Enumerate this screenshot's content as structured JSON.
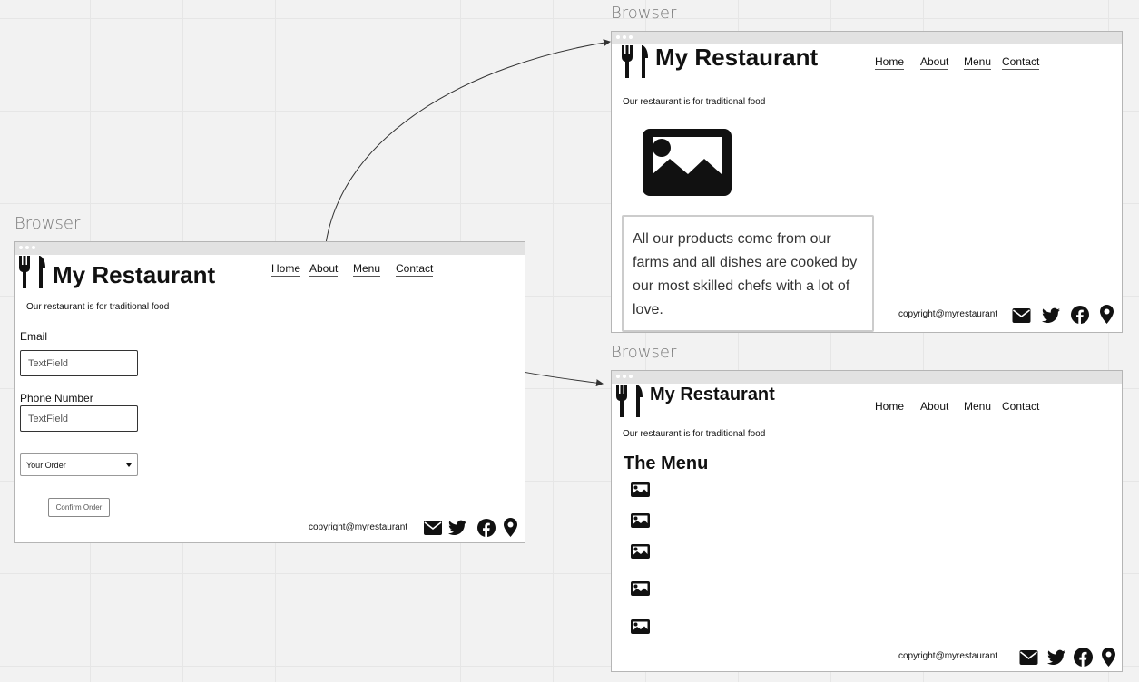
{
  "canvas": {
    "label": "Browser"
  },
  "site": {
    "name": "My Restaurant",
    "tagline": "Our restaurant is for traditional food",
    "copyright": "copyright@myrestaurant",
    "nav": [
      "Home",
      "About",
      "Menu",
      "Contact"
    ],
    "icons": [
      "fork-knife-icon",
      "envelope-icon",
      "twitter-icon",
      "facebook-icon",
      "map-pin-icon",
      "image-icon"
    ]
  },
  "contact_page": {
    "email_label": "Email",
    "email_value": "TextField",
    "phone_label": "Phone Number",
    "phone_value": "TextField",
    "order_select_value": "Your Order",
    "confirm_label": "Confirm Order"
  },
  "about_page": {
    "description": "All our products come from our farms and all dishes are cooked by our most skilled chefs with a lot of love."
  },
  "menu_page": {
    "heading": "The Menu",
    "item_count": 5
  }
}
